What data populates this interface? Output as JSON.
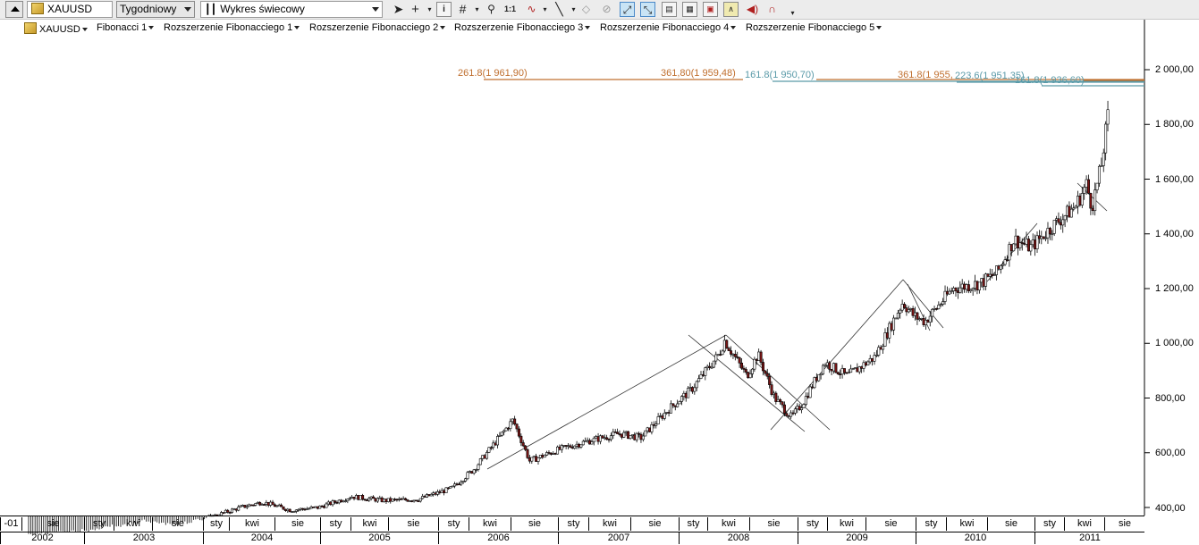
{
  "toolbar": {
    "collapse_icon": "collapse-up-icon",
    "symbol": "XAUUSD",
    "interval": "Tygodniowy",
    "chart_type": "Wykres świecowy",
    "one_to_one": "1:1"
  },
  "menu": {
    "symbol": "XAUUSD",
    "items": [
      "Fibonacci 1",
      "Rozszerzenie Fibonacciego 1",
      "Rozszerzenie Fibonacciego 2",
      "Rozszerzenie Fibonacciego 3",
      "Rozszerzenie Fibonacciego 4",
      "Rozszerzenie Fibonacciego 5"
    ]
  },
  "fib_labels": [
    {
      "text": "261.8(1 961,90)",
      "color": "#c07030"
    },
    {
      "text": "361,80(1 959,48)",
      "color": "#c07030"
    },
    {
      "text": "161.8(1 950,70)",
      "color": "#5a9aa8"
    },
    {
      "text": "361.8(1 955,",
      "color": "#c07030"
    },
    {
      "text": "223.6(1 951,35)",
      "color": "#5a9aa8"
    },
    {
      "text": "161.8(1 936,60)",
      "color": "#5a9aa8"
    }
  ],
  "price_axis": [
    "2 000,00",
    "1 800,00",
    "1 600,00",
    "1 400,00",
    "1 200,00",
    "1 000,00",
    "800,00",
    "600,00",
    "400,00"
  ],
  "time_axis": {
    "months": [
      "-01",
      "sie",
      "sty",
      "kwi",
      "sie",
      "sty",
      "kwi",
      "sie",
      "sty",
      "kwi",
      "sie",
      "sty",
      "kwi",
      "sie",
      "sty",
      "kwi",
      "sie",
      "sty",
      "kwi",
      "sie",
      "sty",
      "kwi",
      "sie",
      "sty",
      "kwi",
      "sie",
      "sty",
      "kwi",
      "sie",
      "sty",
      "kwi",
      "sie"
    ],
    "years": [
      "2002",
      "2003",
      "2004",
      "2005",
      "2006",
      "2007",
      "2008",
      "2009",
      "2010",
      "2011"
    ]
  },
  "chart_data": {
    "type": "candlestick",
    "symbol": "XAUUSD",
    "interval": "Tygodniowy",
    "ylim": [
      380,
      2150
    ],
    "x_range": [
      2001.6,
      2011.7
    ],
    "points": [
      [
        2002.0,
        300
      ],
      [
        2002.5,
        310
      ],
      [
        2003.0,
        345
      ],
      [
        2003.3,
        330
      ],
      [
        2003.6,
        360
      ],
      [
        2003.9,
        400
      ],
      [
        2004.1,
        420
      ],
      [
        2004.35,
        390
      ],
      [
        2004.6,
        400
      ],
      [
        2004.9,
        440
      ],
      [
        2005.2,
        425
      ],
      [
        2005.5,
        430
      ],
      [
        2005.8,
        470
      ],
      [
        2006.0,
        540
      ],
      [
        2006.35,
        720
      ],
      [
        2006.5,
        570
      ],
      [
        2006.75,
        610
      ],
      [
        2007.0,
        640
      ],
      [
        2007.3,
        670
      ],
      [
        2007.5,
        655
      ],
      [
        2007.75,
        760
      ],
      [
        2007.95,
        830
      ],
      [
        2008.2,
        960
      ],
      [
        2008.25,
        1010
      ],
      [
        2008.45,
        880
      ],
      [
        2008.55,
        960
      ],
      [
        2008.7,
        800
      ],
      [
        2008.85,
        730
      ],
      [
        2008.95,
        780
      ],
      [
        2009.15,
        930
      ],
      [
        2009.35,
        880
      ],
      [
        2009.6,
        950
      ],
      [
        2009.85,
        1150
      ],
      [
        2009.95,
        1100
      ],
      [
        2010.05,
        1080
      ],
      [
        2010.3,
        1200
      ],
      [
        2010.55,
        1220
      ],
      [
        2010.7,
        1260
      ],
      [
        2010.85,
        1380
      ],
      [
        2011.0,
        1350
      ],
      [
        2011.2,
        1430
      ],
      [
        2011.4,
        1500
      ],
      [
        2011.5,
        1580
      ],
      [
        2011.55,
        1500
      ],
      [
        2011.63,
        1640
      ],
      [
        2011.67,
        1760
      ],
      [
        2011.7,
        1850
      ]
    ]
  }
}
